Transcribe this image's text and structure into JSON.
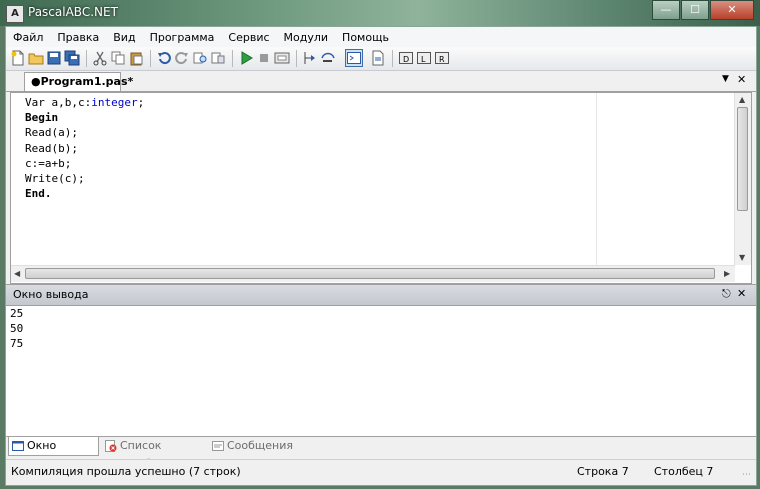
{
  "window": {
    "title": "PascalABC.NET",
    "app_icon": "pascal-icon"
  },
  "menu": [
    "Файл",
    "Правка",
    "Вид",
    "Программа",
    "Сервис",
    "Модули",
    "Помощь"
  ],
  "editor_tab": {
    "label": "●Program1.pas*"
  },
  "code_lines": [
    {
      "pre": "Var a,b,c:",
      "type": "integer",
      "post": ";"
    },
    {
      "kw": "Begin"
    },
    {
      "text": "Read(a);"
    },
    {
      "text": "Read(b);"
    },
    {
      "text": "c:=a+b;"
    },
    {
      "text": "Write(c);"
    },
    {
      "kw": "End."
    }
  ],
  "output_panel": {
    "title": "Окно вывода",
    "lines": [
      "25",
      "50",
      "75"
    ]
  },
  "bottom_tabs": [
    "Окно вывода",
    "Список ошибок",
    "Сообщения компилятора"
  ],
  "status": {
    "message": "Компиляция прошла успешно (7 строк)",
    "row_label": "Строка",
    "row": "7",
    "col_label": "Столбец",
    "col": "7"
  },
  "colors": {
    "keyword_type": "#0000cc"
  }
}
